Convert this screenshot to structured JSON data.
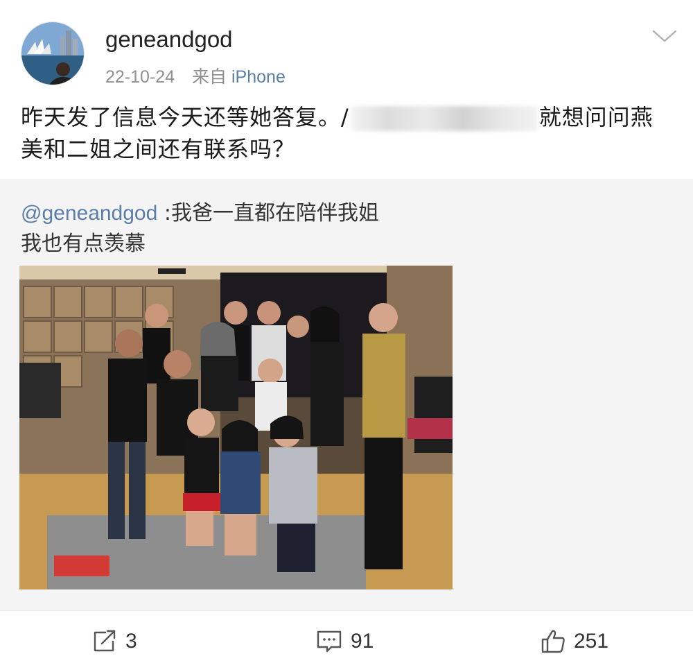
{
  "post": {
    "username": "geneandgod",
    "date": "22-10-24",
    "source_prefix": "来自",
    "source_device": "iPhone",
    "text_line1_before": "昨天发了信息今天还等她答复。/",
    "text_line1_after": "就想问问燕",
    "text_line2": "美和二姐之间还有联系吗？"
  },
  "quoted": {
    "mention": "@geneandgod",
    "text_line1": " :我爸一直都在陪伴我姐",
    "text_line2": "我也有点羡慕"
  },
  "actions": {
    "repost_count": "3",
    "comment_count": "91",
    "like_count": "251"
  },
  "icons": {
    "menu": "chevron-down-icon",
    "repost": "share-icon",
    "comment": "comment-icon",
    "like": "thumbs-up-icon"
  },
  "colors": {
    "link_blue": "#5a7ea8",
    "quoted_bg": "#f4f4f4",
    "meta_gray": "#8f8f8f"
  }
}
